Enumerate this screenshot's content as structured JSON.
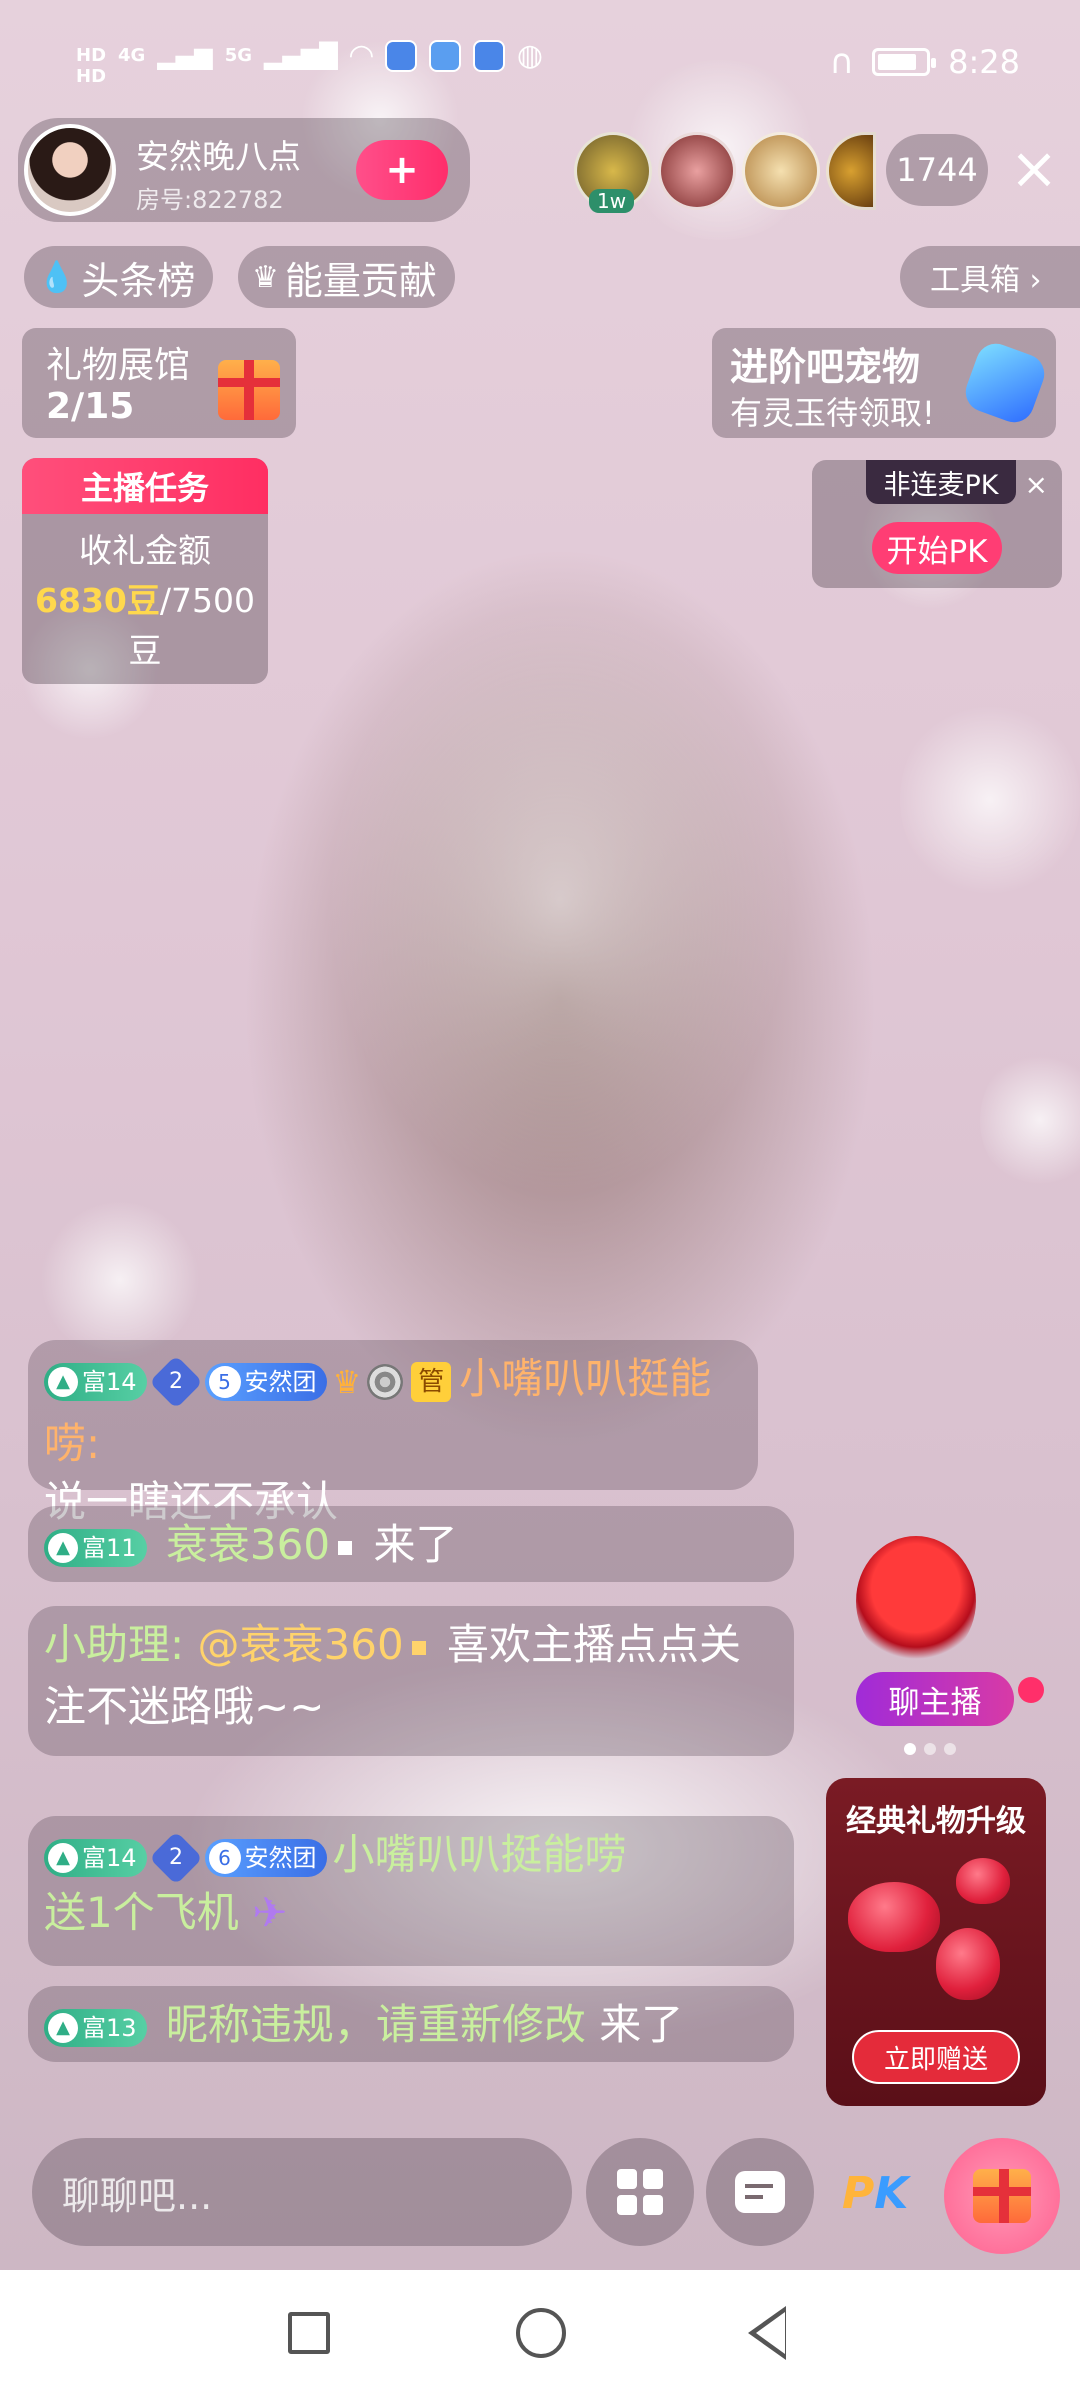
{
  "status_bar": {
    "time": "8:28",
    "network_1": "HD",
    "network_2": "HD",
    "signal_label": "4G",
    "signal_label_2": "5G"
  },
  "host": {
    "name": "安然晚八点",
    "room": "房号:822782",
    "follow_label": "+"
  },
  "top_viewers": {
    "badge": "1w",
    "count": "1744"
  },
  "close_label": "×",
  "tags": {
    "headline": "头条榜",
    "energy": "能量贡献",
    "toolbox": "工具箱 ›"
  },
  "gift_hall": {
    "title": "礼物展馆",
    "progress": "2/15"
  },
  "pet_banner": {
    "title": "进阶吧宠物",
    "subtitle": "有灵玉待领取!"
  },
  "task": {
    "header": "主播任务",
    "label": "收礼金额",
    "current": "6830豆",
    "target": "/7500",
    "unit": "豆"
  },
  "pk_card": {
    "tag": "非连麦PK",
    "close": "×",
    "start": "开始PK"
  },
  "chat": {
    "msg1": {
      "rich_level": "富14",
      "star_level": "2",
      "fan_level": "5",
      "fan_group": "安然团",
      "manager_badge": "管",
      "user": "小嘴叭叭挺能唠:",
      "text": "说一瞎还不承认"
    },
    "msg2": {
      "rich_level": "富11",
      "user": "衰衰360",
      "text": "来了"
    },
    "msg3": {
      "user": "小助理:",
      "mention": "@衰衰360",
      "text": "喜欢主播点点关注不迷路哦~~"
    },
    "msg4": {
      "rich_level": "富14",
      "star_level": "2",
      "fan_level": "6",
      "fan_group": "安然团",
      "user": "小嘴叭叭挺能唠",
      "text": "送1个飞机"
    },
    "msg5": {
      "rich_level": "富13",
      "user": "昵称违规，请重新修改",
      "text": "来了"
    }
  },
  "side": {
    "chat_host": "聊主播",
    "upgrade_title": "经典礼物升级",
    "upgrade_button": "立即赠送"
  },
  "bottom": {
    "input_placeholder": "聊聊吧...",
    "pk_p": "P",
    "pk_k": "K"
  },
  "colors": {
    "accent_pink": "#ff3d74",
    "rich_badge_green": "#2fae86",
    "fan_badge_blue": "#3a6ee6",
    "username_orange": "#ffb36b",
    "username_green": "#c9ef9e",
    "highlight_yellow": "#ffd84d"
  }
}
